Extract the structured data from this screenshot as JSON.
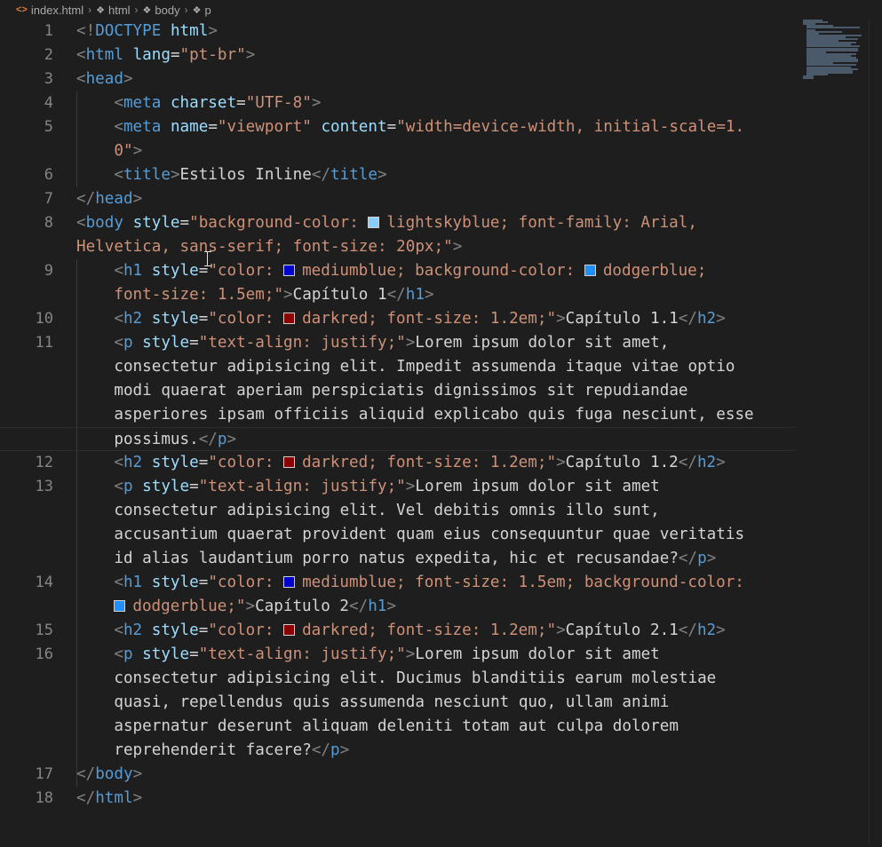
{
  "breadcrumb": [
    {
      "label": "index.html",
      "icon": "html-file-icon"
    },
    {
      "label": "html",
      "icon": "element-cube-icon"
    },
    {
      "label": "body",
      "icon": "element-cube-icon"
    },
    {
      "label": "p",
      "icon": "element-cube-icon"
    }
  ],
  "colors": {
    "lightskyblue": "#87cefa",
    "mediumblue": "#0000cd",
    "dodgerblue": "#1e90ff",
    "darkred": "#8b0000"
  },
  "lines": [
    {
      "n": "1",
      "tokens": [
        [
          "p",
          "<!"
        ],
        [
          "tag",
          "DOCTYPE"
        ],
        [
          "txt",
          " "
        ],
        [
          "attr",
          "html"
        ],
        [
          "p",
          ">"
        ]
      ]
    },
    {
      "n": "2",
      "tokens": [
        [
          "p",
          "<"
        ],
        [
          "tag",
          "html"
        ],
        [
          "txt",
          " "
        ],
        [
          "attr",
          "lang"
        ],
        [
          "txt",
          "="
        ],
        [
          "str",
          "\"pt-br\""
        ],
        [
          "p",
          ">"
        ]
      ]
    },
    {
      "n": "3",
      "tokens": [
        [
          "p",
          "<"
        ],
        [
          "tag",
          "head"
        ],
        [
          "p",
          ">"
        ]
      ]
    },
    {
      "n": "4",
      "tokens": [
        [
          "txt",
          "    "
        ],
        [
          "p",
          "<"
        ],
        [
          "tag",
          "meta"
        ],
        [
          "txt",
          " "
        ],
        [
          "attr",
          "charset"
        ],
        [
          "txt",
          "="
        ],
        [
          "str",
          "\"UTF-8\""
        ],
        [
          "p",
          ">"
        ]
      ]
    },
    {
      "n": "5",
      "tokens": [
        [
          "txt",
          "    "
        ],
        [
          "p",
          "<"
        ],
        [
          "tag",
          "meta"
        ],
        [
          "txt",
          " "
        ],
        [
          "attr",
          "name"
        ],
        [
          "txt",
          "="
        ],
        [
          "str",
          "\"viewport\""
        ],
        [
          "txt",
          " "
        ],
        [
          "attr",
          "content"
        ],
        [
          "txt",
          "="
        ],
        [
          "str",
          "\"width=device-width, initial-scale=1."
        ]
      ]
    },
    {
      "n": "",
      "tokens": [
        [
          "txt",
          "    "
        ],
        [
          "str",
          "0\""
        ],
        [
          "p",
          ">"
        ]
      ]
    },
    {
      "n": "6",
      "tokens": [
        [
          "txt",
          "    "
        ],
        [
          "p",
          "<"
        ],
        [
          "tag",
          "title"
        ],
        [
          "p",
          ">"
        ],
        [
          "txt",
          "Estilos Inline"
        ],
        [
          "p",
          "</"
        ],
        [
          "tag",
          "title"
        ],
        [
          "p",
          ">"
        ]
      ]
    },
    {
      "n": "7",
      "tokens": [
        [
          "p",
          "</"
        ],
        [
          "tag",
          "head"
        ],
        [
          "p",
          ">"
        ]
      ]
    },
    {
      "n": "8",
      "tokens": [
        [
          "p",
          "<"
        ],
        [
          "tag",
          "body"
        ],
        [
          "txt",
          " "
        ],
        [
          "attr",
          "style"
        ],
        [
          "txt",
          "="
        ],
        [
          "str",
          "\"background-color: "
        ],
        [
          "sw",
          "lightskyblue"
        ],
        [
          "str",
          "lightskyblue; font-family: Arial,"
        ]
      ]
    },
    {
      "n": "",
      "tokens": [
        [
          "str",
          "Helvetica, sans-serif; font-size: 20px;\""
        ],
        [
          "p",
          ">"
        ]
      ]
    },
    {
      "n": "9",
      "tokens": [
        [
          "txt",
          "    "
        ],
        [
          "p",
          "<"
        ],
        [
          "tag",
          "h1"
        ],
        [
          "txt",
          " "
        ],
        [
          "attr",
          "style"
        ],
        [
          "txt",
          "="
        ],
        [
          "str",
          "\"color: "
        ],
        [
          "sw",
          "mediumblue"
        ],
        [
          "str",
          "mediumblue; background-color: "
        ],
        [
          "sw",
          "dodgerblue"
        ],
        [
          "str",
          "dodgerblue;"
        ]
      ]
    },
    {
      "n": "",
      "tokens": [
        [
          "txt",
          "    "
        ],
        [
          "str",
          "font-size: 1.5em;\""
        ],
        [
          "p",
          ">"
        ],
        [
          "txt",
          "Capítulo 1"
        ],
        [
          "p",
          "</"
        ],
        [
          "tag",
          "h1"
        ],
        [
          "p",
          ">"
        ]
      ]
    },
    {
      "n": "10",
      "tokens": [
        [
          "txt",
          "    "
        ],
        [
          "p",
          "<"
        ],
        [
          "tag",
          "h2"
        ],
        [
          "txt",
          " "
        ],
        [
          "attr",
          "style"
        ],
        [
          "txt",
          "="
        ],
        [
          "str",
          "\"color: "
        ],
        [
          "sw",
          "darkred"
        ],
        [
          "str",
          "darkred; font-size: 1.2em;\""
        ],
        [
          "p",
          ">"
        ],
        [
          "txt",
          "Capítulo 1.1"
        ],
        [
          "p",
          "</"
        ],
        [
          "tag",
          "h2"
        ],
        [
          "p",
          ">"
        ]
      ]
    },
    {
      "n": "11",
      "tokens": [
        [
          "txt",
          "    "
        ],
        [
          "p",
          "<"
        ],
        [
          "tag",
          "p"
        ],
        [
          "txt",
          " "
        ],
        [
          "attr",
          "style"
        ],
        [
          "txt",
          "="
        ],
        [
          "str",
          "\"text-align: justify;\""
        ],
        [
          "p",
          ">"
        ],
        [
          "txt",
          "Lorem ipsum dolor sit amet,"
        ]
      ]
    },
    {
      "n": "",
      "tokens": [
        [
          "txt",
          "    consectetur adipisicing elit. Impedit assumenda itaque vitae optio"
        ]
      ]
    },
    {
      "n": "",
      "tokens": [
        [
          "txt",
          "    modi quaerat aperiam perspiciatis dignissimos sit repudiandae"
        ]
      ]
    },
    {
      "n": "",
      "tokens": [
        [
          "txt",
          "    asperiores ipsam officiis aliquid explicabo quis fuga nesciunt, esse"
        ]
      ]
    },
    {
      "n": "",
      "current": true,
      "tokens": [
        [
          "txt",
          "    possimus."
        ],
        [
          "p",
          "</"
        ],
        [
          "tag",
          "p"
        ],
        [
          "p",
          ">"
        ]
      ]
    },
    {
      "n": "12",
      "tokens": [
        [
          "txt",
          "    "
        ],
        [
          "p",
          "<"
        ],
        [
          "tag",
          "h2"
        ],
        [
          "txt",
          " "
        ],
        [
          "attr",
          "style"
        ],
        [
          "txt",
          "="
        ],
        [
          "str",
          "\"color: "
        ],
        [
          "sw",
          "darkred"
        ],
        [
          "str",
          "darkred; font-size: 1.2em;\""
        ],
        [
          "p",
          ">"
        ],
        [
          "txt",
          "Capítulo 1.2"
        ],
        [
          "p",
          "</"
        ],
        [
          "tag",
          "h2"
        ],
        [
          "p",
          ">"
        ]
      ]
    },
    {
      "n": "13",
      "tokens": [
        [
          "txt",
          "    "
        ],
        [
          "p",
          "<"
        ],
        [
          "tag",
          "p"
        ],
        [
          "txt",
          " "
        ],
        [
          "attr",
          "style"
        ],
        [
          "txt",
          "="
        ],
        [
          "str",
          "\"text-align: justify;\""
        ],
        [
          "p",
          ">"
        ],
        [
          "txt",
          "Lorem ipsum dolor sit amet"
        ]
      ]
    },
    {
      "n": "",
      "tokens": [
        [
          "txt",
          "    consectetur adipisicing elit. Vel debitis omnis illo sunt,"
        ]
      ]
    },
    {
      "n": "",
      "tokens": [
        [
          "txt",
          "    accusantium quaerat provident quam eius consequuntur quae veritatis"
        ]
      ]
    },
    {
      "n": "",
      "tokens": [
        [
          "txt",
          "    id alias laudantium porro natus expedita, hic et recusandae?"
        ],
        [
          "p",
          "</"
        ],
        [
          "tag",
          "p"
        ],
        [
          "p",
          ">"
        ]
      ]
    },
    {
      "n": "14",
      "tokens": [
        [
          "txt",
          "    "
        ],
        [
          "p",
          "<"
        ],
        [
          "tag",
          "h1"
        ],
        [
          "txt",
          " "
        ],
        [
          "attr",
          "style"
        ],
        [
          "txt",
          "="
        ],
        [
          "str",
          "\"color: "
        ],
        [
          "sw",
          "mediumblue"
        ],
        [
          "str",
          "mediumblue; font-size: 1.5em; background-color:"
        ]
      ]
    },
    {
      "n": "",
      "tokens": [
        [
          "txt",
          "    "
        ],
        [
          "sw",
          "dodgerblue"
        ],
        [
          "str",
          "dodgerblue;\""
        ],
        [
          "p",
          ">"
        ],
        [
          "txt",
          "Capítulo 2"
        ],
        [
          "p",
          "</"
        ],
        [
          "tag",
          "h1"
        ],
        [
          "p",
          ">"
        ]
      ]
    },
    {
      "n": "15",
      "tokens": [
        [
          "txt",
          "    "
        ],
        [
          "p",
          "<"
        ],
        [
          "tag",
          "h2"
        ],
        [
          "txt",
          " "
        ],
        [
          "attr",
          "style"
        ],
        [
          "txt",
          "="
        ],
        [
          "str",
          "\"color: "
        ],
        [
          "sw",
          "darkred"
        ],
        [
          "str",
          "darkred; font-size: 1.2em;\""
        ],
        [
          "p",
          ">"
        ],
        [
          "txt",
          "Capítulo 2.1"
        ],
        [
          "p",
          "</"
        ],
        [
          "tag",
          "h2"
        ],
        [
          "p",
          ">"
        ]
      ]
    },
    {
      "n": "16",
      "tokens": [
        [
          "txt",
          "    "
        ],
        [
          "p",
          "<"
        ],
        [
          "tag",
          "p"
        ],
        [
          "txt",
          " "
        ],
        [
          "attr",
          "style"
        ],
        [
          "txt",
          "="
        ],
        [
          "str",
          "\"text-align: justify;\""
        ],
        [
          "p",
          ">"
        ],
        [
          "txt",
          "Lorem ipsum dolor sit amet"
        ]
      ]
    },
    {
      "n": "",
      "tokens": [
        [
          "txt",
          "    consectetur adipisicing elit. Ducimus blanditiis earum molestiae"
        ]
      ]
    },
    {
      "n": "",
      "tokens": [
        [
          "txt",
          "    quasi, repellendus quis assumenda nesciunt quo, ullam animi"
        ]
      ]
    },
    {
      "n": "",
      "tokens": [
        [
          "txt",
          "    aspernatur deserunt aliquam deleniti totam aut culpa dolorem"
        ]
      ]
    },
    {
      "n": "",
      "tokens": [
        [
          "txt",
          "    reprehenderit facere?"
        ],
        [
          "p",
          "</"
        ],
        [
          "tag",
          "p"
        ],
        [
          "p",
          ">"
        ]
      ]
    },
    {
      "n": "17",
      "tokens": [
        [
          "p",
          "</"
        ],
        [
          "tag",
          "body"
        ],
        [
          "p",
          ">"
        ]
      ]
    },
    {
      "n": "18",
      "tokens": [
        [
          "p",
          "</"
        ],
        [
          "tag",
          "html"
        ],
        [
          "p",
          ">"
        ]
      ]
    }
  ]
}
